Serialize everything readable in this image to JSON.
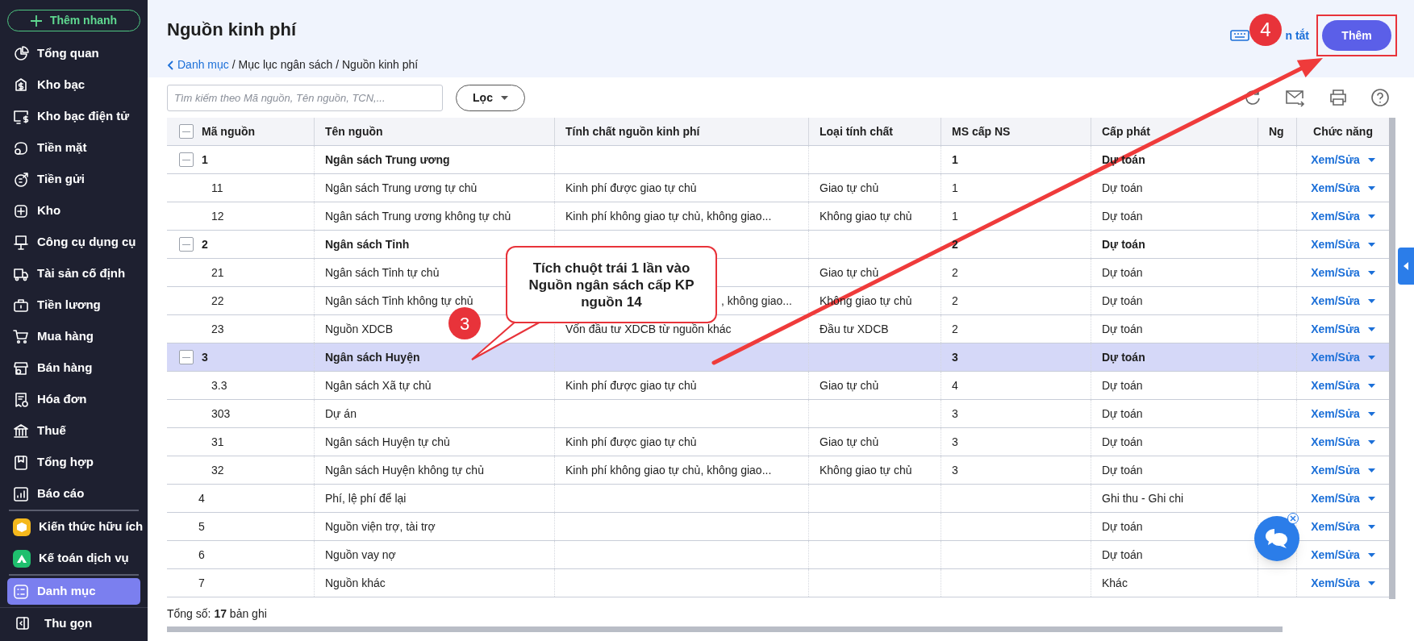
{
  "sidebar": {
    "quick_add": "Thêm nhanh",
    "sections": [
      [
        {
          "label": "Tổng quan",
          "selected": false
        },
        {
          "label": "Kho bạc",
          "selected": false
        },
        {
          "label": "Kho bạc điện tử",
          "selected": false
        },
        {
          "label": "Tiền mặt",
          "selected": false
        },
        {
          "label": "Tiền gửi",
          "selected": false
        },
        {
          "label": "Kho",
          "selected": false
        },
        {
          "label": "Công cụ dụng cụ",
          "selected": false
        },
        {
          "label": "Tài sản cố định",
          "selected": false
        },
        {
          "label": "Tiền lương",
          "selected": false
        },
        {
          "label": "Mua hàng",
          "selected": false
        },
        {
          "label": "Bán hàng",
          "selected": false
        },
        {
          "label": "Hóa đơn",
          "selected": false
        },
        {
          "label": "Thuế",
          "selected": false
        },
        {
          "label": "Tổng hợp",
          "selected": false
        },
        {
          "label": "Báo cáo",
          "selected": false
        }
      ],
      [
        {
          "label": "Kiến thức hữu ích",
          "selected": false,
          "color": "#f5b81c"
        },
        {
          "label": "Kế toán dịch vụ",
          "selected": false,
          "color": "#1fbf6e"
        }
      ],
      [
        {
          "label": "Danh mục",
          "selected": true
        }
      ]
    ],
    "collapse": "Thu gọn"
  },
  "page": {
    "title": "Nguồn kinh phí",
    "breadcrumb": {
      "back": "Danh mục",
      "trail": "/ Mục lục ngân sách / Nguồn kinh phí"
    },
    "shortcut_link": "n tắt",
    "add_button": "Thêm"
  },
  "toolbar": {
    "search": {
      "placeholder": "Tìm kiếm theo Mã nguồn, Tên nguồn, TCN,..."
    },
    "filter": "Lọc"
  },
  "table": {
    "select_all_partial": true,
    "columns": [
      "Mã nguồn",
      "Tên nguồn",
      "Tính chất nguồn kinh phí",
      "Loại tính chất",
      "MS cấp NS",
      "Cấp phát",
      "Ng",
      "Chức năng"
    ],
    "rows": [
      {
        "code": "1",
        "name": "Ngân sách Trung ương",
        "ms": "1",
        "cap": "Dự toán",
        "action": "Xem/Sửa",
        "selected": false,
        "expanded": true,
        "children": [
          {
            "code": "11",
            "name": "Ngân sách Trung ương tự chủ",
            "nature": "Kinh phí được giao tự chủ",
            "type": "Giao tự chủ",
            "ms": "1",
            "cap": "Dự toán",
            "action": "Xem/Sửa",
            "selected": false
          },
          {
            "code": "12",
            "name": "Ngân sách Trung ương không tự chủ",
            "nature": "Kinh phí không giao tự chủ, không giao...",
            "type": "Không giao tự chủ",
            "ms": "1",
            "cap": "Dự toán",
            "action": "Xem/Sửa",
            "selected": false
          }
        ]
      },
      {
        "code": "2",
        "name": "Ngân sách Tỉnh",
        "ms": "2",
        "cap": "Dự toán",
        "action": "Xem/Sửa",
        "selected": false,
        "expanded": true,
        "children": [
          {
            "code": "21",
            "name": "Ngân sách Tỉnh tự chủ",
            "type": "Giao tự chủ",
            "ms": "2",
            "cap": "Dự toán",
            "action": "Xem/Sửa",
            "selected": false
          },
          {
            "code": "22",
            "name": "Ngân sách Tỉnh không tự chủ",
            "nature_tail": ", không giao...",
            "type": "Không giao tự chủ",
            "ms": "2",
            "cap": "Dự toán",
            "action": "Xem/Sửa",
            "selected": false
          },
          {
            "code": "23",
            "name": "Nguồn XDCB",
            "nature": "Vốn đầu tư XDCB từ nguồn khác",
            "type": "Đầu tư XDCB",
            "ms": "2",
            "cap": "Dự toán",
            "action": "Xem/Sửa",
            "selected": false
          }
        ]
      },
      {
        "code": "3",
        "name": "Ngân sách Huyện",
        "ms": "3",
        "cap": "Dự toán",
        "action": "Xem/Sửa",
        "selected": true,
        "expanded": true,
        "children": [
          {
            "code": "3.3",
            "name": "Ngân sách Xã tự chủ",
            "nature": "Kinh phí được giao tự chủ",
            "type": "Giao tự chủ",
            "ms": "4",
            "cap": "Dự toán",
            "action": "Xem/Sửa",
            "selected": false
          },
          {
            "code": "303",
            "name": "Dự án",
            "ms": "3",
            "cap": "Dự toán",
            "action": "Xem/Sửa",
            "selected": false
          },
          {
            "code": "31",
            "name": "Ngân sách Huyện tự chủ",
            "nature": "Kinh phí được giao tự chủ",
            "type": "Giao tự chủ",
            "ms": "3",
            "cap": "Dự toán",
            "action": "Xem/Sửa",
            "selected": false
          },
          {
            "code": "32",
            "name": "Ngân sách Huyện không tự chủ",
            "nature": "Kinh phí không giao tự chủ, không giao...",
            "type": "Không giao tự chủ",
            "ms": "3",
            "cap": "Dự toán",
            "action": "Xem/Sửa",
            "selected": false
          }
        ]
      },
      {
        "code": "4",
        "name": "Phí, lệ phí để lại",
        "cap": "Ghi thu - Ghi chi",
        "action": "Xem/Sửa",
        "selected": false
      },
      {
        "code": "5",
        "name": "Nguồn viện trợ, tài trợ",
        "cap": "Dự toán",
        "action": "Xem/Sửa",
        "selected": false
      },
      {
        "code": "6",
        "name": "Nguồn vay nợ",
        "cap": "Dự toán",
        "action": "Xem/Sửa",
        "selected": false
      },
      {
        "code": "7",
        "name": "Nguồn khác",
        "cap": "Khác",
        "action": "Xem/Sửa",
        "selected": false
      }
    ],
    "total": "Tổng số:  **17** bản ghi"
  },
  "annotations": {
    "callout": "Tích chuột trái 1 lần vào Nguồn ngân sách cấp KP nguồn 14",
    "markers": [
      {
        "label": "3"
      },
      {
        "label": "4"
      }
    ]
  }
}
